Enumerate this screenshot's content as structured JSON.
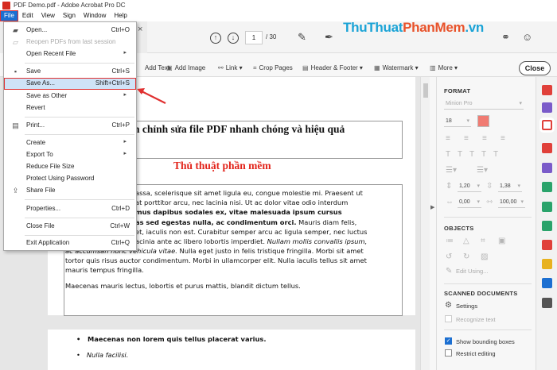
{
  "window": {
    "title": "PDF Demo.pdf - Adobe Acrobat Pro DC"
  },
  "watermark": {
    "part1": "ThuThuat",
    "part2": "PhanMem",
    "part3": ".vn"
  },
  "menubar": {
    "items": [
      "File",
      "Edit",
      "View",
      "Sign",
      "Window",
      "Help"
    ]
  },
  "toolbar": {
    "page_current": "1",
    "page_total": "/ 30",
    "close_label": "Close"
  },
  "edit_toolbar": {
    "items": [
      "Add Text",
      "Add Image",
      "Link",
      "Crop Pages",
      "Header & Footer",
      "Watermark",
      "More"
    ]
  },
  "file_menu": {
    "items": [
      {
        "label": "Open...",
        "shortcut": "Ctrl+O"
      },
      {
        "label": "Reopen PDFs from last session",
        "shortcut": ""
      },
      {
        "label": "Open Recent File",
        "shortcut": ""
      },
      {
        "label": "Save",
        "shortcut": "Ctrl+S"
      },
      {
        "label": "Save As...",
        "shortcut": "Shift+Ctrl+S"
      },
      {
        "label": "Save as Other",
        "shortcut": ""
      },
      {
        "label": "Revert",
        "shortcut": ""
      },
      {
        "label": "Print...",
        "shortcut": "Ctrl+P"
      },
      {
        "label": "Create",
        "shortcut": ""
      },
      {
        "label": "Export To",
        "shortcut": ""
      },
      {
        "label": "Reduce File Size",
        "shortcut": ""
      },
      {
        "label": "Protect Using Password",
        "shortcut": ""
      },
      {
        "label": "Share File",
        "shortcut": ""
      },
      {
        "label": "Properties...",
        "shortcut": "Ctrl+D"
      },
      {
        "label": "Close File",
        "shortcut": "Ctrl+W"
      },
      {
        "label": "Exit Application",
        "shortcut": "Ctrl+Q"
      }
    ]
  },
  "document": {
    "title": "n chỉnh sửa file PDF nhanh chóng và hiệu quả",
    "subtitle": "Thủ thuật phần mềm",
    "p1_lines": [
      "assa, scelerisque sit amet ligula eu, congue molestie mi. Praesent ut",
      "at porttitor arcu, nec lacinia nisi. Ut ac dolor vitae odio interdum",
      "mus dapibus sodales ex, vitae malesuada ipsum cursus",
      "as sed egestas nulla, ac condimentum orci.",
      " Mauris diam felis,",
      "et, iaculis non est. Curabitur semper arcu ac ligula semper, nec luctus",
      "acinia ante ac libero lobortis imperdiet. ",
      "Nullam mollis convallis ipsum,",
      "ac accumsan nunc vehicula vitae.",
      " Nulla eget justo in felis tristique fringilla. Morbi sit amet",
      "tortor quis risus auctor condimentum. Morbi in ullamcorper elit. Nulla iaculis tellus sit amet",
      "mauris tempus fringilla."
    ],
    "p2": "Maecenas mauris lectus, lobortis et purus mattis, blandit dictum tellus.",
    "bullet1": "Maecenas non lorem quis tellus placerat varius.",
    "bullet2": "Nulla facilisi."
  },
  "format_panel": {
    "format_heading": "FORMAT",
    "font_name": "Minion Pro",
    "font_size": "18",
    "line_spacing": "1,20",
    "char_spacing": "1,38",
    "scale": "0,00",
    "rotation": "100,00",
    "objects_heading": "OBJECTS",
    "edit_using": "Edit Using...",
    "scanned_heading": "SCANNED DOCUMENTS",
    "settings_label": "Settings",
    "recognize_label": "Recognize text",
    "show_boxes_label": "Show bounding boxes",
    "restrict_label": "Restrict editing",
    "accent_color": "#f07b72"
  },
  "colors": {
    "accent_blue": "#1c6fd1",
    "highlight_red": "#e03030",
    "brand_red": "#d62c20"
  }
}
